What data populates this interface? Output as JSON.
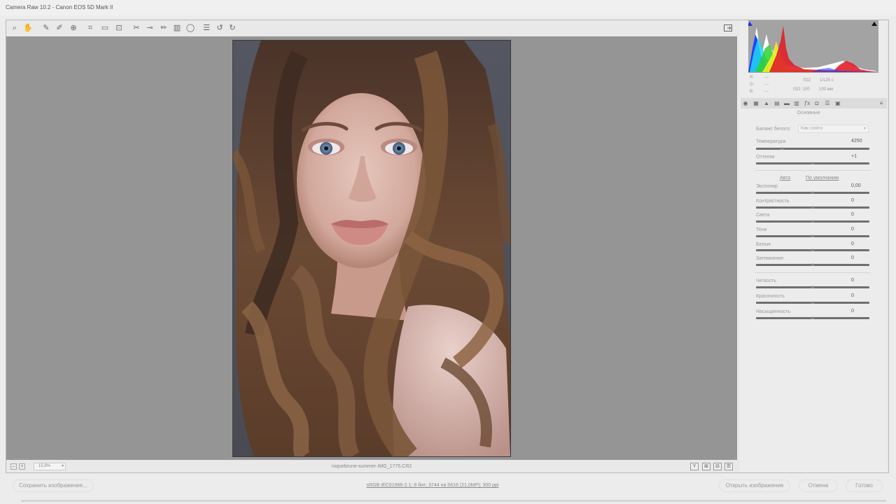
{
  "window": {
    "title": "Camera Raw 10.2  -  Canon EOS 5D Mark II"
  },
  "toolbar": {
    "tools": [
      {
        "icon": "zoom-icon",
        "glyph": "⌕"
      },
      {
        "icon": "hand-icon",
        "glyph": "✋"
      },
      {
        "icon": "white-balance-icon",
        "glyph": "✎"
      },
      {
        "icon": "color-sampler-icon",
        "glyph": "✐"
      },
      {
        "icon": "targeted-adjustment-icon",
        "glyph": "⊕"
      },
      {
        "icon": "crop-icon",
        "glyph": "⌗"
      },
      {
        "icon": "straighten-icon",
        "glyph": "▭"
      },
      {
        "icon": "transform-icon",
        "glyph": "⊡"
      },
      {
        "icon": "spot-removal-icon",
        "glyph": "✂"
      },
      {
        "icon": "red-eye-icon",
        "glyph": "⊸"
      },
      {
        "icon": "adjustment-brush-icon",
        "glyph": "✏"
      },
      {
        "icon": "graduated-filter-icon",
        "glyph": "▥"
      },
      {
        "icon": "radial-filter-icon",
        "glyph": "◯"
      },
      {
        "icon": "preferences-icon",
        "glyph": "☰"
      },
      {
        "icon": "rotate-left-icon",
        "glyph": "↺"
      },
      {
        "icon": "rotate-right-icon",
        "glyph": "↻"
      }
    ],
    "fullscreen_icon": "fullscreen-icon"
  },
  "statusbar": {
    "zoom": "15,9%",
    "filename": "roquebrune-summer-IMG_1775.CR2",
    "view_buttons": [
      "Y",
      "⊞",
      "⊟",
      "☰"
    ]
  },
  "histogram": {
    "colors": {
      "red": "#e0202a",
      "green": "#28c828",
      "blue": "#2030f0",
      "cyan": "#20d8f0",
      "yellow": "#f0f020",
      "white": "#ffffff"
    }
  },
  "info": {
    "r_label": "R:",
    "g_label": "G:",
    "b_label": "B:",
    "r": "---",
    "g": "---",
    "b": "---",
    "aperture": "f/22",
    "shutter": "1/125 с",
    "iso": "ISO: 100",
    "lens": "100 мм"
  },
  "panel": {
    "tabs": [
      "basic-tab-icon",
      "tone-curve-tab-icon",
      "detail-tab-icon",
      "hsl-tab-icon",
      "split-toning-tab-icon",
      "lens-tab-icon",
      "effects-tab-icon",
      "camera-calibration-tab-icon",
      "presets-tab-icon",
      "snapshots-tab-icon"
    ],
    "section_title": "Основные",
    "wb_label": "Баланс белого:",
    "wb_value": "Как снято",
    "auto_link": "Авто",
    "default_link": "По умолчанию",
    "sliders": {
      "temperature": {
        "label": "Температура",
        "value": "4250",
        "level": 0.23
      },
      "tint": {
        "label": "Оттенок",
        "value": "+1",
        "level": 0.5
      },
      "exposure": {
        "label": "Экспонир",
        "value": "0,00",
        "level": 0.5
      },
      "contrast": {
        "label": "Контрастность",
        "value": "0",
        "level": 0.5
      },
      "highlights": {
        "label": "Света",
        "value": "0",
        "level": 0.5
      },
      "shadows": {
        "label": "Тени",
        "value": "0",
        "level": 0.5
      },
      "whites": {
        "label": "Белые",
        "value": "0",
        "level": 0.5
      },
      "blacks": {
        "label": "Затемнение",
        "value": "0",
        "level": 0.5
      },
      "clarity": {
        "label": "Четкость",
        "value": "0",
        "level": 0.5
      },
      "vibrance": {
        "label": "Красочность",
        "value": "0",
        "level": 0.5
      },
      "saturation": {
        "label": "Насыщенность",
        "value": "0",
        "level": 0.5
      }
    }
  },
  "footer": {
    "save_label": "Сохранить изображение...",
    "meta": "sRGB IEC61966-2.1; 8 бит; 3744 на 5616 (21,0МР); 300 ppi",
    "open_label": "Открыть изображение",
    "cancel_label": "Отмена",
    "done_label": "Готово"
  }
}
